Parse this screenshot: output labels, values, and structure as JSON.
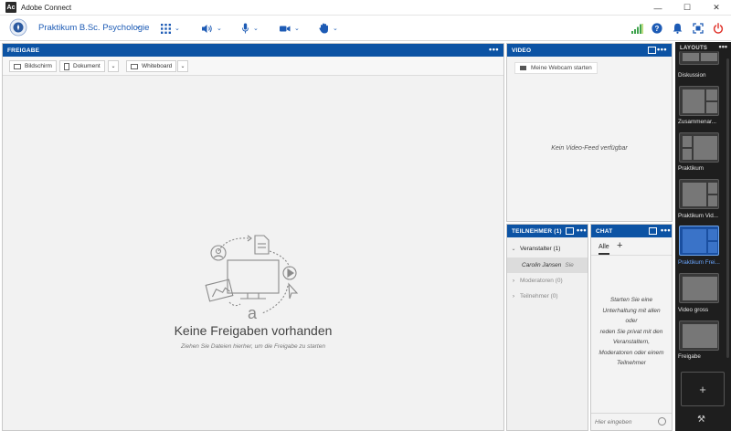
{
  "window": {
    "title": "Adobe Connect",
    "logo_text": "Ac",
    "minimize": "—",
    "maximize": "☐",
    "close": "✕"
  },
  "header": {
    "room_name": "Praktikum B.Sc. Psychologie",
    "caret": "⌄"
  },
  "share_pod": {
    "title": "FREIGABE",
    "menu": "•••",
    "buttons": {
      "screen": "Bildschirm",
      "document": "Dokument",
      "whiteboard": "Whiteboard"
    },
    "dropdown": "⌄",
    "empty_title": "Keine Freigaben vorhanden",
    "empty_subtitle": "Ziehen Sie Dateien hierher, um die Freigabe zu starten",
    "art_letter": "a"
  },
  "video_pod": {
    "title": "VIDEO",
    "menu": "•••",
    "webcam_button": "Meine Webcam starten",
    "no_feed": "Kein Video-Feed verfügbar"
  },
  "attendees_pod": {
    "title": "TEILNEHMER  (1)",
    "menu": "•••",
    "groups": [
      {
        "label": "Veranstalter (1)",
        "chevron": "⌄"
      },
      {
        "label": "Moderatoren (0)",
        "chevron": "›"
      },
      {
        "label": "Teilnehmer (0)",
        "chevron": "›"
      }
    ],
    "host_entry": {
      "name": "Carolin Jansen",
      "tag": "Sie"
    }
  },
  "chat_pod": {
    "title": "CHAT",
    "menu": "•••",
    "tab": "Alle",
    "add_tab": "+",
    "empty_lines": [
      "Starten Sie eine",
      "Unterhaltung mit allen",
      "oder",
      "reden Sie privat mit den",
      "Veranstaltern,",
      "Moderatoren oder einem",
      "Teilnehmer"
    ],
    "input_placeholder": "Hier eingeben"
  },
  "layouts_panel": {
    "title": "LAYOUTS",
    "menu": "•••",
    "items": [
      {
        "label": "Diskussion",
        "selected": false
      },
      {
        "label": "Zusammenar...",
        "selected": false
      },
      {
        "label": "Praktikum",
        "selected": false
      },
      {
        "label": "Praktikum Vid...",
        "selected": false
      },
      {
        "label": "Praktikum Frei...",
        "selected": true
      },
      {
        "label": "Video gross",
        "selected": false
      },
      {
        "label": "Freigabe",
        "selected": false
      }
    ],
    "add": "+",
    "tools_icon": "⚒"
  },
  "icons": {
    "apps": "grid-icon",
    "audio": "speaker-icon",
    "mic": "microphone-icon",
    "camera": "camera-icon",
    "raise_hand": "hand-icon",
    "connection": "signal-bars-icon",
    "help": "help-icon",
    "notifications": "bell-icon",
    "fullscreen": "fullscreen-icon",
    "leave": "power-icon"
  },
  "colors": {
    "accent": "#0c53a4",
    "link": "#1d5bb5",
    "sidebar": "#1e1e1e",
    "selected": "#3a73c8",
    "signal_green": "#3fa34d",
    "power_red": "#e0332b"
  }
}
